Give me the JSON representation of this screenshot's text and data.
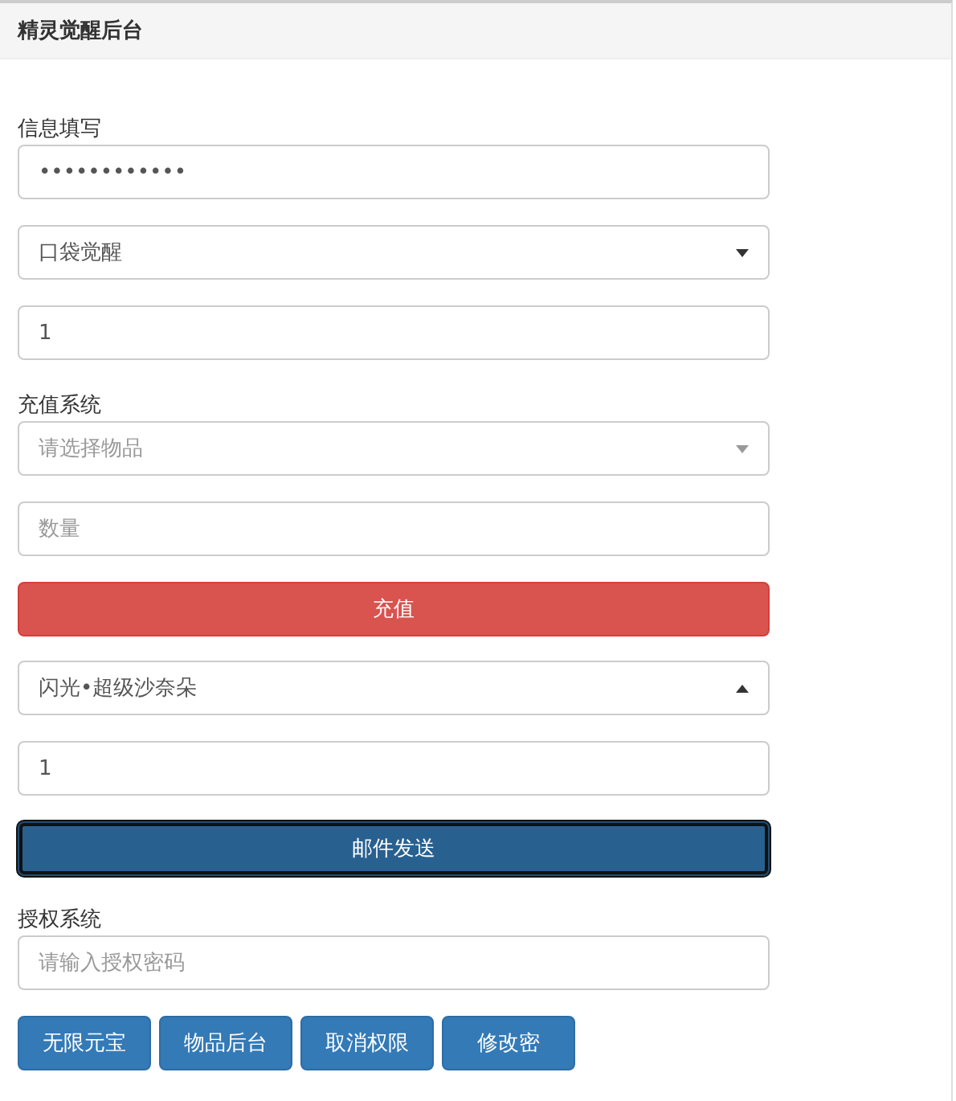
{
  "panel": {
    "title": "精灵觉醒后台"
  },
  "rows": [
    {
      "kind": "label",
      "text": "信息填写"
    },
    {
      "kind": "password",
      "value": "••••••••••••"
    },
    {
      "kind": "select",
      "value": "口袋觉醒",
      "expanded": false
    },
    {
      "kind": "input",
      "value": "1"
    },
    {
      "kind": "label",
      "text": "充值系统"
    },
    {
      "kind": "select",
      "placeholder": "请选择物品",
      "expanded": false
    },
    {
      "kind": "input",
      "placeholder": "数量"
    },
    {
      "kind": "danger",
      "text": "充值"
    },
    {
      "kind": "select",
      "value": "闪光•超级沙奈朵",
      "expanded": true
    },
    {
      "kind": "input",
      "value": "1"
    },
    {
      "kind": "primary",
      "focused": true,
      "text": "邮件发送"
    },
    {
      "kind": "label",
      "text": "授权系统"
    },
    {
      "kind": "input",
      "placeholder": "请输入授权密码"
    }
  ],
  "buttons": [
    {
      "text": "无限元宝"
    },
    {
      "text": "物品后台"
    },
    {
      "text": "取消权限"
    },
    {
      "text": "修改密"
    }
  ]
}
